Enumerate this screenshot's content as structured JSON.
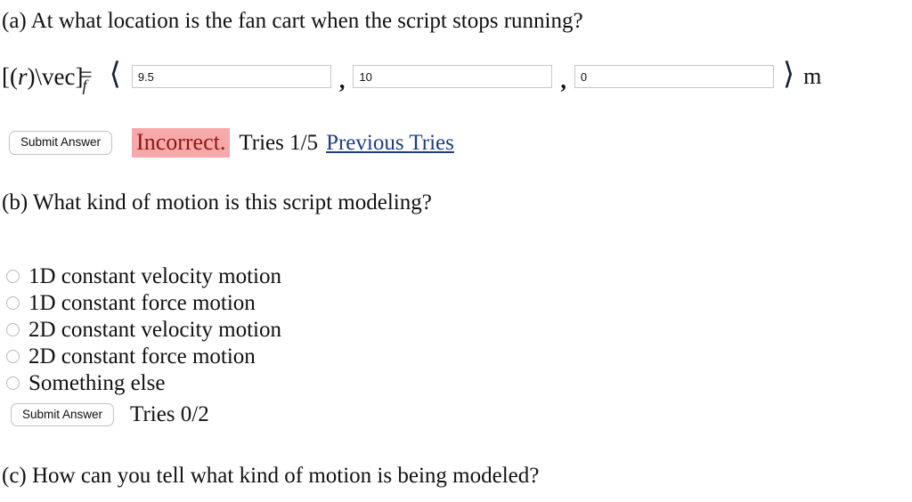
{
  "parts": {
    "a": {
      "prompt": "(a) At what location is the fan cart when the script stops running?",
      "math_label": {
        "open": "[(",
        "var": "r",
        "close": ")\\vec]",
        "subscript": "f",
        "equals": "="
      },
      "bracket_open": "⟨",
      "bracket_close": "⟩",
      "comma": ",",
      "unit": "m",
      "inputs": [
        {
          "name": "x-component",
          "value": "9.5",
          "placeholder": ""
        },
        {
          "name": "y-component",
          "value": "10",
          "placeholder": ""
        },
        {
          "name": "z-component",
          "value": "0",
          "placeholder": ""
        }
      ],
      "submit_label": "Submit Answer",
      "feedback": "Incorrect.",
      "feedback_bg": "#f7a9a9",
      "feedback_color": "#8e1616",
      "tries": "Tries 1/5",
      "previous_tries_link": "Previous Tries",
      "link_color": "#1d3d85"
    },
    "b": {
      "prompt": "(b) What kind of motion is this script modeling?",
      "options": [
        {
          "label": "1D constant velocity motion",
          "selected": false
        },
        {
          "label": "1D constant force motion",
          "selected": false
        },
        {
          "label": "2D constant velocity motion",
          "selected": false
        },
        {
          "label": "2D constant force motion",
          "selected": false
        },
        {
          "label": "Something else",
          "selected": false
        }
      ],
      "submit_label": "Submit Answer",
      "tries": "Tries 0/2"
    },
    "c": {
      "prompt": "(c) How can you tell what kind of motion is being modeled?"
    }
  }
}
